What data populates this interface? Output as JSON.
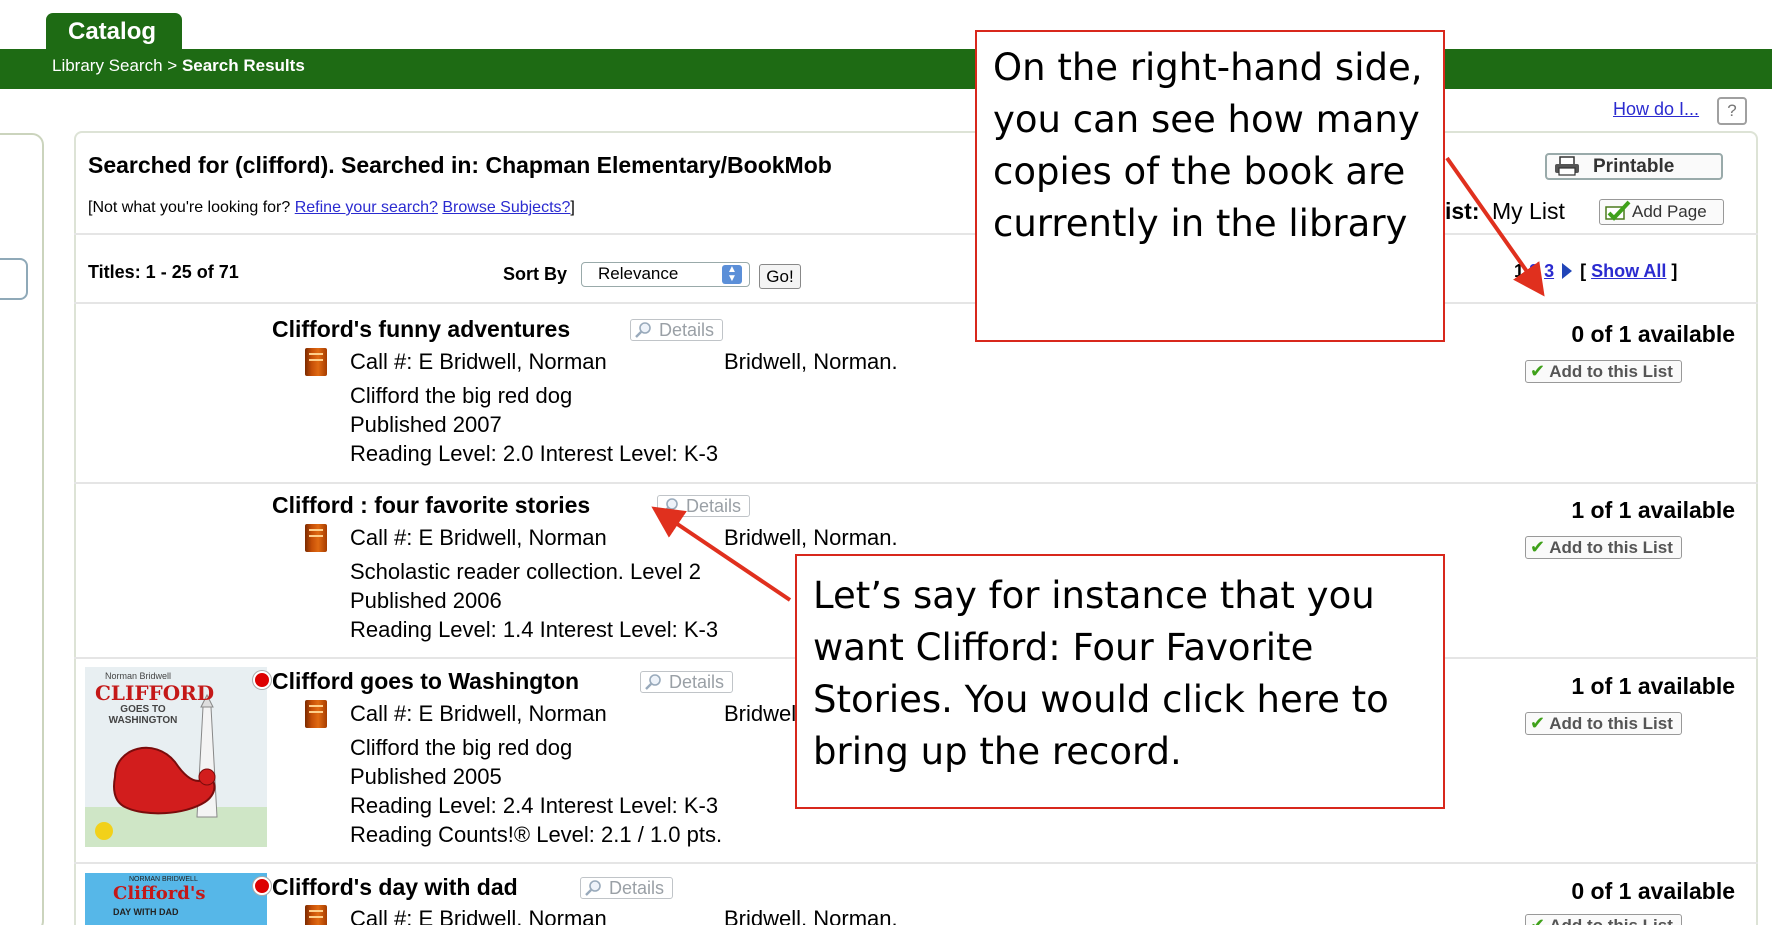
{
  "header": {
    "tab_label": "Catalog",
    "breadcrumb_root": "Library Search",
    "breadcrumb_sep": " > ",
    "breadcrumb_current": "Search Results",
    "bar_color": "#1e6b14"
  },
  "help": {
    "how_do_i": "How do I...",
    "help_icon": "?"
  },
  "search": {
    "summary": "Searched for (clifford). Searched in: Chapman Elementary/BookMob",
    "refine_prefix": "[Not what you're looking for? ",
    "refine_link": "Refine your search?",
    "browse_link": "Browse Subjects?",
    "refine_suffix": "]"
  },
  "toolbar": {
    "printable": "Printable",
    "list_label": "ist:",
    "my_list": "My List",
    "add_page": "Add Page"
  },
  "results_bar": {
    "titles": "Titles: 1 - 25 of 71",
    "sort_by": "Sort By",
    "sort_value": "Relevance",
    "go": "Go!",
    "pages": [
      "1",
      "2",
      "3"
    ],
    "show_all": "Show All",
    "show_all_open": "[ ",
    "show_all_close": " ]"
  },
  "results": [
    {
      "title": "Clifford's funny adventures",
      "details": "Details",
      "call": "Call #: E Bridwell, Norman",
      "author": "Bridwell, Norman.",
      "lines": [
        "Clifford the big red dog",
        "Published 2007",
        "Reading Level: 2.0  Interest Level: K-3"
      ],
      "availability": "0 of 1 available",
      "add": "Add to this List"
    },
    {
      "title": "Clifford : four favorite stories",
      "details": "Details",
      "call": "Call #: E Bridwell, Norman",
      "author": "Bridwell, Norman.",
      "lines": [
        "Scholastic reader collection. Level 2",
        "Published 2006",
        "Reading Level: 1.4  Interest Level: K-3"
      ],
      "availability": "1 of 1 available",
      "add": "Add to this List"
    },
    {
      "title": "Clifford goes to Washington",
      "details": "Details",
      "call": "Call #: E Bridwell, Norman",
      "author": "Bridwell, Norman.",
      "lines": [
        "Clifford the big red dog",
        "Published 2005",
        "Reading Level: 2.4  Interest Level: K-3",
        "Reading Counts!® Level: 2.1 / 1.0 pts."
      ],
      "availability": "1 of 1 available",
      "add": "Add to this List",
      "cover_title": "CLIFFORD",
      "cover_sub": "GOES TO WASHINGTON",
      "cover_author": "Norman Bridwell"
    },
    {
      "title": "Clifford's day with dad",
      "details": "Details",
      "call": "Call #: E Bridwell, Norman",
      "author": "Bridwell, Norman.",
      "availability": "0 of 1 available",
      "add": "Add to this List",
      "cover_title": "Clifford's",
      "cover_sub": "DAY WITH DAD",
      "cover_author": "NORMAN BRIDWELL"
    }
  ],
  "callouts": {
    "top": "On the right-hand side, you can see how many copies of the book are currently in the library",
    "bottom": "Let’s say for instance that you want Clifford: Four Favorite Stories.  You would click here to bring up the record."
  },
  "colors": {
    "link": "#2b2bd0",
    "callout_border": "#d8281c",
    "arrow": "#e0301e"
  }
}
